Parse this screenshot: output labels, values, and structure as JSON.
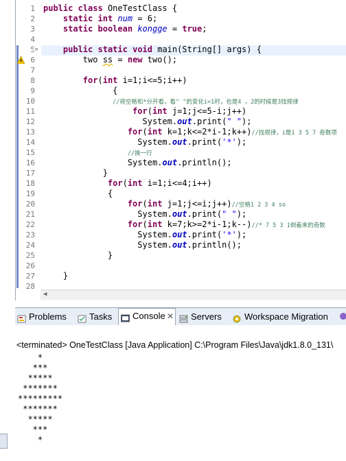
{
  "editor": {
    "lines": [
      {
        "n": "1",
        "html": "<span class=\"kw\">public</span> <span class=\"kw\">class</span> OneTestClass {"
      },
      {
        "n": "2",
        "html": "    <span class=\"kw\">static</span> <span class=\"kw\">int</span> <span class=\"fld\">num</span> = 6;"
      },
      {
        "n": "3",
        "html": "    <span class=\"kw\">static</span> <span class=\"kw\">boolean</span> <span class=\"fld\">kongge</span> = <span class=\"kw\">true</span>;"
      },
      {
        "n": "4",
        "html": ""
      },
      {
        "n": "5",
        "html": "    <span class=\"kw\">public</span> <span class=\"kw\">static</span> <span class=\"kw\">void</span> main(String[] args) {"
      },
      {
        "n": "6",
        "html": "        two <u style=\"text-decoration-style:wavy;text-decoration-color:#e0b400\">ss</u> = <span class=\"kw\">new</span> two();"
      },
      {
        "n": "7",
        "html": ""
      },
      {
        "n": "8",
        "html": "        <span class=\"kw\">for</span>(<span class=\"kw\">int</span> i=1;i&lt;=5;i++)"
      },
      {
        "n": "9",
        "html": "              {"
      },
      {
        "n": "10",
        "html": "              <span class=\"cmt\">//将空格和*分开看，看\" \"的变化i=1时，也是4 ，2的时候是3找规律</span>"
      },
      {
        "n": "11",
        "html": "                  <span class=\"kw\">for</span>(<span class=\"kw\">int</span> j=1;j&lt;=5-i;j++)"
      },
      {
        "n": "12",
        "html": "                    System.<span class=\"sfld\">out</span>.print(<span class=\"str\">\" \"</span>);"
      },
      {
        "n": "13",
        "html": "                 <span class=\"kw\">for</span>(<span class=\"kw\">int</span> k=1;k&lt;=2*i-1;k++)<span class=\"cmt\">//找规律，i是1 3 5 7 奇数项</span>"
      },
      {
        "n": "14",
        "html": "                   System.<span class=\"sfld\">out</span>.print(<span class=\"str\">'*'</span>);"
      },
      {
        "n": "15",
        "html": "                 <span class=\"cmt\">//换一行</span>"
      },
      {
        "n": "16",
        "html": "                 System.<span class=\"sfld\">out</span>.println();"
      },
      {
        "n": "17",
        "html": "            }"
      },
      {
        "n": "18",
        "html": "             <span class=\"kw\">for</span>(<span class=\"kw\">int</span> i=1;i&lt;=4;i++)"
      },
      {
        "n": "19",
        "html": "             {"
      },
      {
        "n": "20",
        "html": "                 <span class=\"kw\">for</span>(<span class=\"kw\">int</span> j=1;j&lt;=i;j++)<span class=\"cmt\">//空格1 2 3 4 so</span>"
      },
      {
        "n": "21",
        "html": "                   System.<span class=\"sfld\">out</span>.print(<span class=\"str\">\" \"</span>);"
      },
      {
        "n": "22",
        "html": "                 <span class=\"kw\">for</span>(<span class=\"kw\">int</span> k=7;k&gt;=2*i-1;k--)<span class=\"cmt\">//* 7 5 3 1倒着来的奇数</span>"
      },
      {
        "n": "23",
        "html": "                   System.<span class=\"sfld\">out</span>.print(<span class=\"str\">'*'</span>);"
      },
      {
        "n": "24",
        "html": "                   System.<span class=\"sfld\">out</span>.println();"
      },
      {
        "n": "25",
        "html": "             }"
      },
      {
        "n": "26",
        "html": ""
      },
      {
        "n": "27",
        "html": "    }"
      },
      {
        "n": "28",
        "html": ""
      }
    ]
  },
  "tabs": [
    {
      "label": "Problems",
      "icon": "problems-icon"
    },
    {
      "label": "Tasks",
      "icon": "tasks-icon"
    },
    {
      "label": "Console",
      "icon": "console-icon",
      "active": true
    },
    {
      "label": "Servers",
      "icon": "servers-icon"
    },
    {
      "label": "Workspace Migration",
      "icon": "workspace-migration-icon"
    }
  ],
  "console": {
    "terminated": "<terminated> OneTestClass [Java Application] C:\\Program Files\\Java\\jdk1.8.0_131\\",
    "output": [
      "    *",
      "   ***",
      "  *****",
      " *******",
      "*********",
      " *******",
      "  *****",
      "   ***",
      "    *"
    ]
  }
}
